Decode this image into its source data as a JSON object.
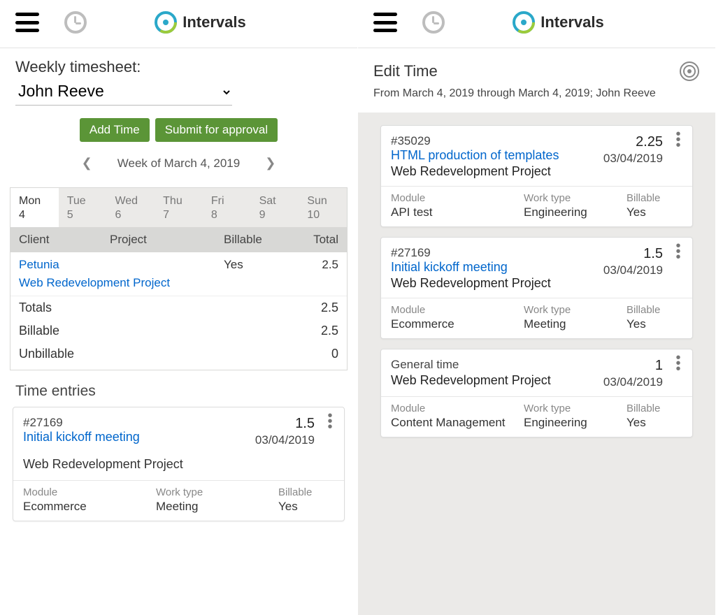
{
  "brand": {
    "name": "Intervals"
  },
  "left": {
    "heading": "Weekly timesheet:",
    "user": "John Reeve",
    "buttons": {
      "add": "Add Time",
      "submit": "Submit for approval"
    },
    "week_label": "Week of March 4, 2019",
    "days": [
      {
        "name": "Mon",
        "num": "4",
        "active": true
      },
      {
        "name": "Tue",
        "num": "5",
        "active": false
      },
      {
        "name": "Wed",
        "num": "6",
        "active": false
      },
      {
        "name": "Thu",
        "num": "7",
        "active": false
      },
      {
        "name": "Fri",
        "num": "8",
        "active": false
      },
      {
        "name": "Sat",
        "num": "9",
        "active": false
      },
      {
        "name": "Sun",
        "num": "10",
        "active": false
      }
    ],
    "columns": {
      "client": "Client",
      "project": "Project",
      "billable": "Billable",
      "total": "Total"
    },
    "row": {
      "client": "Petunia",
      "project": "Web Redevelopment Project",
      "billable": "Yes",
      "total": "2.5"
    },
    "summary": {
      "totals_label": "Totals",
      "totals_val": "2.5",
      "billable_label": "Billable",
      "billable_val": "2.5",
      "unbillable_label": "Unbillable",
      "unbillable_val": "0"
    },
    "entries_title": "Time entries",
    "entry": {
      "id": "#27169",
      "title": "Initial kickoff meeting",
      "duration": "1.5",
      "date": "03/04/2019",
      "project": "Web Redevelopment Project",
      "module_label": "Module",
      "module": "Ecommerce",
      "worktype_label": "Work type",
      "worktype": "Meeting",
      "billable_label": "Billable",
      "billable": "Yes"
    }
  },
  "right": {
    "title": "Edit Time",
    "subtitle": "From March 4, 2019 through March 4, 2019; John Reeve",
    "meta_labels": {
      "module": "Module",
      "worktype": "Work type",
      "billable": "Billable"
    },
    "cards": [
      {
        "id": "#35029",
        "title": "HTML production of templates",
        "project": "Web Redevelopment Project",
        "duration": "2.25",
        "date": "03/04/2019",
        "module": "API test",
        "worktype": "Engineering",
        "billable": "Yes"
      },
      {
        "id": "#27169",
        "title": "Initial kickoff meeting",
        "project": "Web Redevelopment Project",
        "duration": "1.5",
        "date": "03/04/2019",
        "module": "Ecommerce",
        "worktype": "Meeting",
        "billable": "Yes"
      },
      {
        "id": "General time",
        "title": "",
        "project": "Web Redevelopment Project",
        "duration": "1",
        "date": "03/04/2019",
        "module": "Content Management",
        "worktype": "Engineering",
        "billable": "Yes"
      }
    ]
  }
}
